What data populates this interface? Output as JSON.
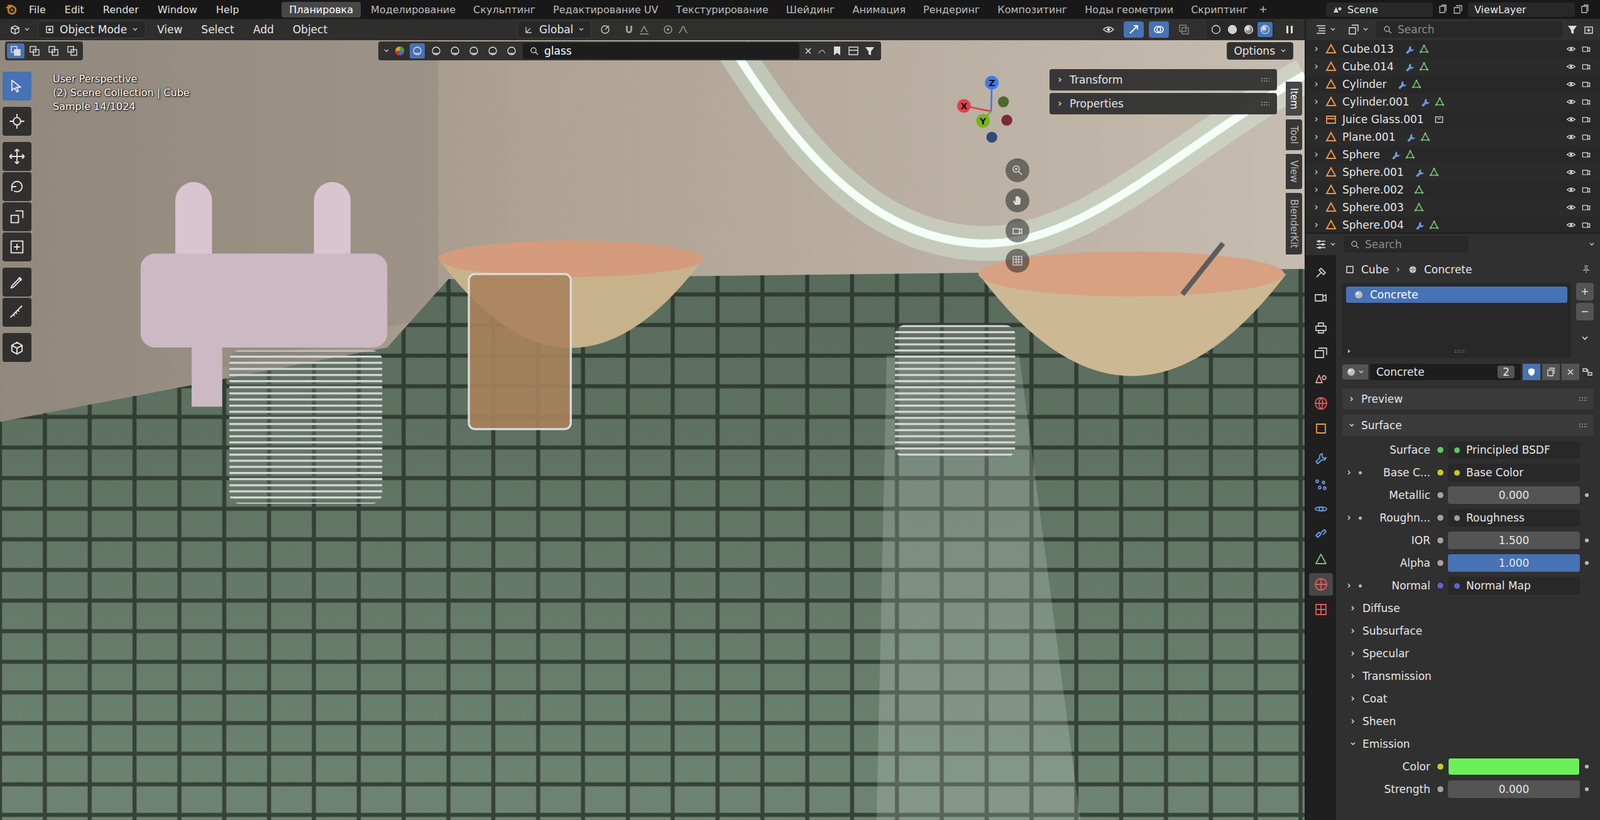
{
  "topbar": {
    "menus": [
      "File",
      "Edit",
      "Render",
      "Window",
      "Help"
    ],
    "workspaces": [
      {
        "label": "Планировка",
        "selected": true
      },
      {
        "label": "Моделирование",
        "selected": false
      },
      {
        "label": "Скульптинг",
        "selected": false
      },
      {
        "label": "Редактирование UV",
        "selected": false
      },
      {
        "label": "Текстурирование",
        "selected": false
      },
      {
        "label": "Шейдинг",
        "selected": false
      },
      {
        "label": "Анимация",
        "selected": false
      },
      {
        "label": "Рендеринг",
        "selected": false
      },
      {
        "label": "Композитинг",
        "selected": false
      },
      {
        "label": "Ноды геометрии",
        "selected": false
      },
      {
        "label": "Скриптинг",
        "selected": false
      }
    ],
    "scene": "Scene",
    "view_layer": "ViewLayer"
  },
  "viewport": {
    "mode": "Object Mode",
    "menus": [
      "View",
      "Select",
      "Add",
      "Object"
    ],
    "orientation": "Global",
    "shading": [
      {
        "kind": "wireframe",
        "selected": false
      },
      {
        "kind": "solid",
        "selected": false
      },
      {
        "kind": "material",
        "selected": false
      },
      {
        "kind": "rendered",
        "selected": true
      }
    ],
    "filter_search": "glass",
    "options": "Options",
    "overlay_text": [
      "User Perspective",
      "(2) Scene Collection | Cube",
      "Sample 14/1024"
    ],
    "axes": [
      {
        "label": "X",
        "color": "#e0414f"
      },
      {
        "label": "Y",
        "color": "#78b31e"
      },
      {
        "label": "Z",
        "color": "#3f7ce0"
      }
    ],
    "sidebar_panels": [
      {
        "label": "Transform",
        "expanded": false
      },
      {
        "label": "Properties",
        "expanded": false
      }
    ],
    "sidebar_tabs": [
      {
        "label": "Item",
        "selected": true
      },
      {
        "label": "Tool",
        "selected": false
      },
      {
        "label": "View",
        "selected": false
      },
      {
        "label": "BlenderKit",
        "selected": false
      }
    ],
    "tools": [
      {
        "kind": "select",
        "selected": true
      },
      {
        "kind": "cursor",
        "selected": false
      },
      {
        "kind": "move",
        "selected": false
      },
      {
        "kind": "rotate",
        "selected": false
      },
      {
        "kind": "scale",
        "selected": false
      },
      {
        "kind": "transform",
        "selected": false
      },
      {
        "kind": "annotate",
        "selected": false
      },
      {
        "kind": "measure",
        "selected": false
      },
      {
        "kind": "add",
        "selected": false
      }
    ]
  },
  "outliner": {
    "search_placeholder": "Search",
    "rows": [
      {
        "label": "Cube.013",
        "kind": "mesh",
        "modifier": true
      },
      {
        "label": "Cube.014",
        "kind": "mesh",
        "modifier": true
      },
      {
        "label": "Cylinder",
        "kind": "mesh",
        "modifier": true
      },
      {
        "label": "Cylinder.001",
        "kind": "mesh",
        "modifier": true
      },
      {
        "label": "Juice Glass.001",
        "kind": "instance",
        "modifier": false
      },
      {
        "label": "Plane.001",
        "kind": "mesh",
        "modifier": true
      },
      {
        "label": "Sphere",
        "kind": "mesh",
        "modifier": true
      },
      {
        "label": "Sphere.001",
        "kind": "mesh",
        "modifier": true
      },
      {
        "label": "Sphere.002",
        "kind": "mesh",
        "modifier": false
      },
      {
        "label": "Sphere.003",
        "kind": "mesh",
        "modifier": false
      },
      {
        "label": "Sphere.004",
        "kind": "mesh",
        "modifier": true
      }
    ]
  },
  "properties": {
    "search_placeholder": "Search",
    "tabs": [
      {
        "kind": "tool",
        "selected": false
      },
      {
        "kind": "render",
        "selected": false
      },
      {
        "kind": "output",
        "selected": false
      },
      {
        "kind": "view_layer",
        "selected": false
      },
      {
        "kind": "scene",
        "selected": false
      },
      {
        "kind": "world",
        "selected": false
      },
      {
        "kind": "object",
        "selected": false
      },
      {
        "kind": "modifier",
        "selected": false
      },
      {
        "kind": "particles",
        "selected": false
      },
      {
        "kind": "physics",
        "selected": false
      },
      {
        "kind": "constraints",
        "selected": false
      },
      {
        "kind": "data",
        "selected": false
      },
      {
        "kind": "material",
        "selected": true
      },
      {
        "kind": "texture",
        "selected": false
      }
    ],
    "breadcrumb": [
      "Cube",
      "Concrete"
    ],
    "slots": [
      {
        "label": "Concrete",
        "selected": true
      }
    ],
    "material": {
      "name": "Concrete",
      "users": "2"
    },
    "panels": [
      {
        "label": "Preview",
        "expanded": false
      },
      {
        "label": "Surface",
        "expanded": true
      }
    ],
    "surface_rows": [
      {
        "label": "Surface",
        "kind": "node",
        "value": "Principled BSDF",
        "color": "#63c763",
        "expandable": false,
        "linked": false,
        "animatable": false
      },
      {
        "label": "Base C...",
        "kind": "node",
        "value": "Base Color",
        "color": "#c7c729",
        "expandable": true,
        "linked": true,
        "animatable": false
      },
      {
        "label": "Metallic",
        "kind": "number",
        "value": "0.000",
        "color": "#a1a1a1",
        "expandable": false,
        "linked": false,
        "animatable": true
      },
      {
        "label": "Roughn...",
        "kind": "node",
        "value": "Roughness",
        "color": "#a1a1a1",
        "expandable": true,
        "linked": true,
        "animatable": false
      },
      {
        "label": "IOR",
        "kind": "number",
        "value": "1.500",
        "color": "#a1a1a1",
        "expandable": false,
        "linked": false,
        "animatable": true
      },
      {
        "label": "Alpha",
        "kind": "slider",
        "value": "1.000",
        "level": 1,
        "color": "#a1a1a1",
        "expandable": false,
        "linked": false,
        "animatable": true
      },
      {
        "label": "Normal",
        "kind": "node",
        "value": "Normal Map",
        "color": "#6363c7",
        "expandable": true,
        "linked": true,
        "animatable": false
      }
    ],
    "subpanels": [
      {
        "label": "Diffuse",
        "expanded": false
      },
      {
        "label": "Subsurface",
        "expanded": false
      },
      {
        "label": "Specular",
        "expanded": false
      },
      {
        "label": "Transmission",
        "expanded": false
      },
      {
        "label": "Coat",
        "expanded": false
      },
      {
        "label": "Sheen",
        "expanded": false
      },
      {
        "label": "Emission",
        "expanded": true
      }
    ],
    "emission_rows": [
      {
        "label": "Color",
        "kind": "color",
        "swatch": "#6cf05a",
        "color": "#c7c729",
        "animatable": true
      },
      {
        "label": "Strength",
        "kind": "number",
        "value": "0.000",
        "color": "#a1a1a1",
        "animatable": true
      }
    ]
  }
}
